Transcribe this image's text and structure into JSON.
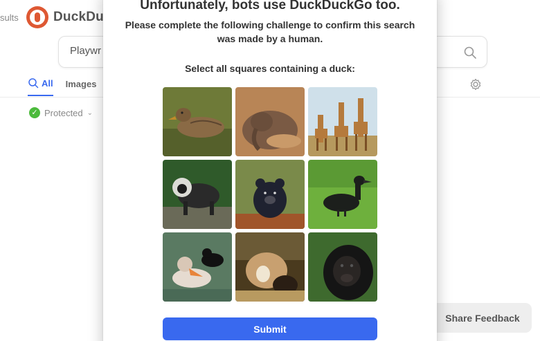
{
  "background": {
    "results_label": "sults",
    "logo_text": "DuckDuc",
    "search": {
      "value": "Playwr"
    },
    "tabs": [
      {
        "label": "All",
        "icon": "search-icon",
        "active": true
      },
      {
        "label": "Images",
        "active": false
      }
    ],
    "protected_label": "Protected",
    "share_feedback_label": "Share Feedback",
    "accent": "#3969ef",
    "logo_color": "#de5833"
  },
  "challenge": {
    "title": "Unfortunately, bots use DuckDuckGo too.",
    "subtitle": "Please complete the following challenge to confirm this search was made by a human.",
    "prompt": "Select all squares containing a duck:",
    "tiles": [
      {
        "subject": "duck"
      },
      {
        "subject": "sleeping-elephant"
      },
      {
        "subject": "giraffes"
      },
      {
        "subject": "monkey"
      },
      {
        "subject": "bear-cub"
      },
      {
        "subject": "duck"
      },
      {
        "subject": "ducks"
      },
      {
        "subject": "dogs-painting"
      },
      {
        "subject": "gorilla"
      }
    ],
    "submit_label": "Submit",
    "submit_color": "#3969ef"
  }
}
